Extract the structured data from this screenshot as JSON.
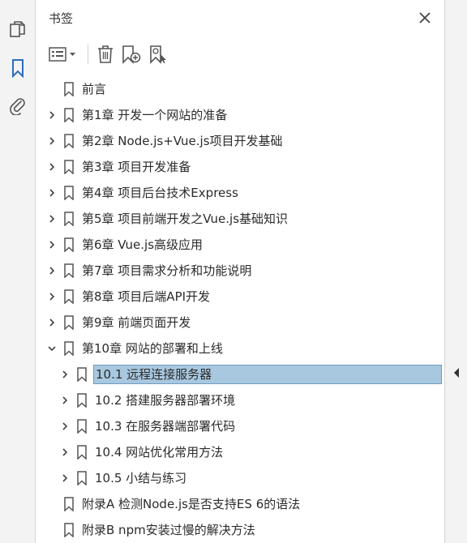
{
  "panel": {
    "title": "书签"
  },
  "bookmarks": [
    {
      "label": "前言",
      "level": 0,
      "expandable": false
    },
    {
      "label": "第1章 开发一个网站的准备",
      "level": 0,
      "expandable": true
    },
    {
      "label": "第2章 Node.js+Vue.js项目开发基础",
      "level": 0,
      "expandable": true
    },
    {
      "label": "第3章 项目开发准备",
      "level": 0,
      "expandable": true
    },
    {
      "label": "第4章 项目后台技术Express",
      "level": 0,
      "expandable": true
    },
    {
      "label": "第5章 项目前端开发之Vue.js基础知识",
      "level": 0,
      "expandable": true
    },
    {
      "label": "第6章 Vue.js高级应用",
      "level": 0,
      "expandable": true
    },
    {
      "label": "第7章 项目需求分析和功能说明",
      "level": 0,
      "expandable": true
    },
    {
      "label": "第8章 项目后端API开发",
      "level": 0,
      "expandable": true
    },
    {
      "label": "第9章 前端页面开发",
      "level": 0,
      "expandable": true
    },
    {
      "label": "第10章 网站的部署和上线",
      "level": 0,
      "expandable": true,
      "expanded": true
    },
    {
      "label": "10.1 远程连接服务器",
      "level": 1,
      "expandable": true,
      "selected": true
    },
    {
      "label": "10.2 搭建服务器部署环境",
      "level": 1,
      "expandable": true
    },
    {
      "label": "10.3 在服务器端部署代码",
      "level": 1,
      "expandable": true
    },
    {
      "label": "10.4 网站优化常用方法",
      "level": 1,
      "expandable": true
    },
    {
      "label": "10.5 小结与练习",
      "level": 1,
      "expandable": true
    },
    {
      "label": "附录A 检测Node.js是否支持ES 6的语法",
      "level": 0,
      "expandable": false
    },
    {
      "label": "附录B npm安装过慢的解决方法",
      "level": 0,
      "expandable": false
    }
  ],
  "colors": {
    "selection_bg": "#a8c8e0",
    "selection_border": "#6e9cc0",
    "accent_blue": "#2c6fbf",
    "icon_gray": "#555555"
  }
}
